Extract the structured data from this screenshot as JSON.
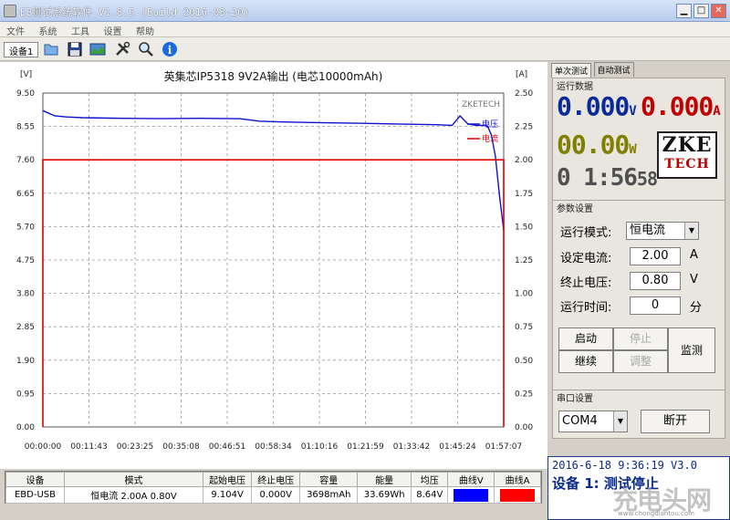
{
  "window": {
    "title": "EB测试系统软件 V1.8.5 (Build 2016-03-20)"
  },
  "menu": [
    "文件",
    "系统",
    "工具",
    "设置",
    "帮助"
  ],
  "toolbar": {
    "device_tab": "设备1"
  },
  "chart_data": {
    "type": "line",
    "title": "英集芯IP5318 9V2A输出 (电芯10000mAh)",
    "y_left_unit": "[V]",
    "y_right_unit": "[A]",
    "y_left_ticks": [
      "9.50",
      "8.55",
      "7.60",
      "6.65",
      "5.70",
      "4.75",
      "3.80",
      "2.85",
      "1.90",
      "0.95",
      "0.00"
    ],
    "y_right_ticks": [
      "2.50",
      "2.25",
      "2.00",
      "1.75",
      "1.50",
      "1.25",
      "1.00",
      "0.75",
      "0.50",
      "0.25",
      "0.00"
    ],
    "x_ticks": [
      "00:00:00",
      "00:11:43",
      "00:23:25",
      "00:35:08",
      "00:46:51",
      "00:58:34",
      "01:10:16",
      "01:21:59",
      "01:33:42",
      "01:45:24",
      "01:57:07"
    ],
    "ylim_left": [
      0,
      9.5
    ],
    "ylim_right": [
      0,
      2.5
    ],
    "xlim_min": [
      0,
      117.1
    ],
    "watermark": "ZKETECH",
    "legend": [
      {
        "name": "电压",
        "color": "#1010d0"
      },
      {
        "name": "电流",
        "color": "#e00000"
      }
    ],
    "series": [
      {
        "name": "电压",
        "axis": "left",
        "color": "#1010d0",
        "x": [
          0,
          1,
          3,
          6,
          10,
          20,
          30,
          40,
          50,
          55,
          60,
          70,
          80,
          90,
          100,
          104,
          106,
          108,
          110,
          112,
          113,
          114,
          115,
          116,
          117.1
        ],
        "y": [
          9.0,
          8.95,
          8.85,
          8.82,
          8.8,
          8.78,
          8.77,
          8.78,
          8.77,
          8.7,
          8.68,
          8.66,
          8.64,
          8.62,
          8.6,
          8.58,
          8.85,
          8.62,
          8.58,
          8.58,
          8.56,
          8.3,
          7.7,
          6.6,
          5.6
        ]
      },
      {
        "name": "电流",
        "axis": "right",
        "color": "#e00000",
        "x": [
          0,
          0,
          117.1,
          117.1
        ],
        "y": [
          0,
          2.0,
          2.0,
          0
        ]
      }
    ]
  },
  "table": {
    "headers": [
      "设备",
      "模式",
      "起始电压",
      "终止电压",
      "容量",
      "能量",
      "均压",
      "曲线V",
      "曲线A"
    ],
    "row": [
      "EBD-USB",
      "恒电流 2.00A 0.80V",
      "9.104V",
      "0.000V",
      "3698mAh",
      "33.69Wh",
      "8.64V"
    ],
    "colors": [
      "#0000ff",
      "#ff0000"
    ]
  },
  "panel": {
    "tabs": [
      "单次测试",
      "自动测试"
    ],
    "run_data_label": "运行数据",
    "voltage": "0.000",
    "voltage_unit": "V",
    "current": "0.000",
    "current_unit": "A",
    "power": "00.00",
    "power_unit": "W",
    "time": "0 1:56",
    "time_sec": "58",
    "logo_line1": "ZKE",
    "logo_line2": "TECH",
    "params_label": "参数设置",
    "mode_label": "运行模式:",
    "mode_value": "恒电流",
    "set_current_label": "设定电流:",
    "set_current_value": "2.00",
    "set_current_unit": "A",
    "end_voltage_label": "终止电压:",
    "end_voltage_value": "0.80",
    "end_voltage_unit": "V",
    "run_time_label": "运行时间:",
    "run_time_value": "0",
    "run_time_unit": "分",
    "btn_start": "启动",
    "btn_stop": "停止",
    "btn_continue": "继续",
    "btn_adjust": "调整",
    "btn_monitor": "监测",
    "serial_label": "串口设置",
    "port_value": "COM4",
    "btn_disconnect": "断开"
  },
  "status": {
    "line1": "2016-6-18 9:36:19 V3.0",
    "line2": "设备 1: 测试停止",
    "watermark": "充电头网",
    "watermark_url": "www.chongdiantou.com"
  },
  "colors": {
    "voltage": "#0a2a9a",
    "current": "#c00000",
    "power": "#808000",
    "time": "#505050"
  }
}
